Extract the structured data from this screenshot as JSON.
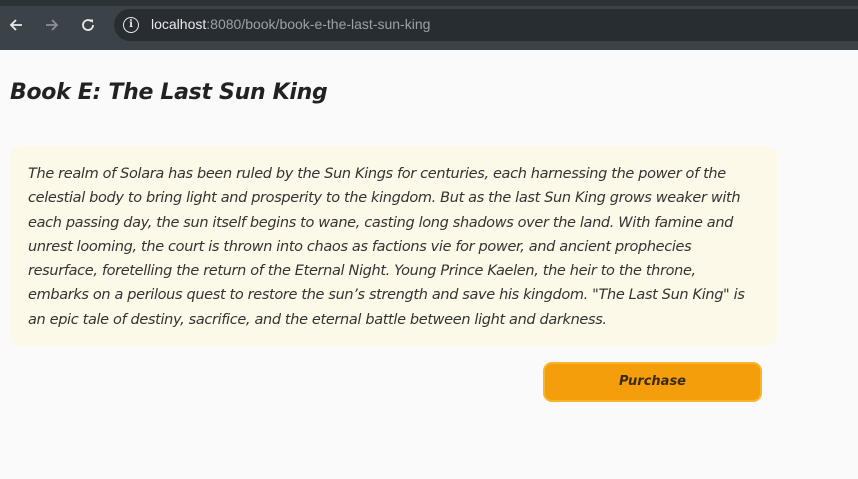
{
  "browser": {
    "url_host": "localhost",
    "url_rest": ":8080/book/book-e-the-last-sun-king"
  },
  "page": {
    "title": "Book E: The Last Sun King",
    "description": "The realm of Solara has been ruled by the Sun Kings for centuries, each harnessing the power of the celestial body to bring light and prosperity to the kingdom. But as the last Sun King grows weaker with each passing day, the sun itself begins to wane, casting long shadows over the land. With famine and unrest looming, the court is thrown into chaos as factions vie for power, and ancient prophecies resurface, foretelling the return of the Eternal Night. Young Prince Kaelen, the heir to the throne, embarks on a perilous quest to restore the sun’s strength and save his kingdom. \"The Last Sun King\" is an epic tale of destiny, sacrifice, and the eternal battle between light and darkness.",
    "purchase_label": "Purchase"
  },
  "icons": {
    "back": "arrow-left-icon",
    "forward": "arrow-right-icon",
    "reload": "reload-icon",
    "site_info": "info-icon"
  },
  "colors": {
    "browser_toolbar": "#3b4348",
    "page_background": "#fafafa",
    "description_background": "#fdf9e8",
    "purchase_button": "#f59e0b"
  }
}
